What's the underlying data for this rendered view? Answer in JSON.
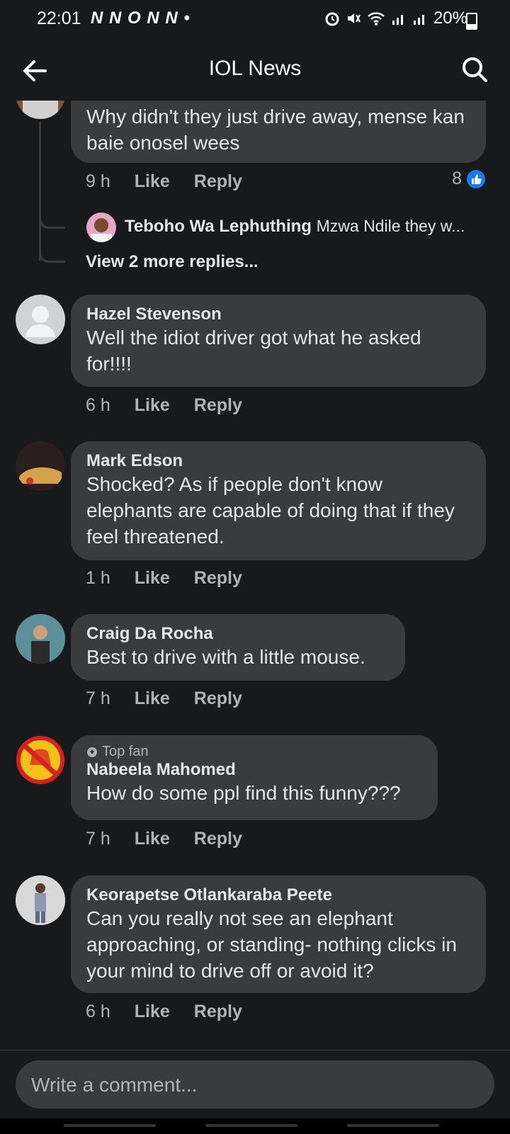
{
  "status_bar": {
    "time": "22:01",
    "notif_icons": "N N O N N •",
    "battery": "20%"
  },
  "header": {
    "title": "IOL News"
  },
  "comments": [
    {
      "id": "c0",
      "text": "Why didn't they just drive away, mense kan baie onosel wees",
      "time": "9 h",
      "like": "Like",
      "reply": "Reply",
      "reactions": "8",
      "reply_preview": {
        "name": "Teboho Wa Lephuthing",
        "text": "Mzwa Ndile they w..."
      },
      "view_more": "View 2 more replies..."
    },
    {
      "id": "c1",
      "name": "Hazel Stevenson",
      "text": "Well the idiot driver got what he asked for!!!!",
      "time": "6 h",
      "like": "Like",
      "reply": "Reply"
    },
    {
      "id": "c2",
      "name": "Mark Edson",
      "text": "Shocked? As if people don't know elephants are capable of doing that if they feel threatened.",
      "time": "1 h",
      "like": "Like",
      "reply": "Reply"
    },
    {
      "id": "c3",
      "name": "Craig Da Rocha",
      "text": "Best to drive with a little mouse.",
      "time": "7 h",
      "like": "Like",
      "reply": "Reply"
    },
    {
      "id": "c4",
      "badge": "Top fan",
      "name": "Nabeela Mahomed",
      "text": "How do some ppl find this funny???",
      "time": "7 h",
      "like": "Like",
      "reply": "Reply"
    },
    {
      "id": "c5",
      "name": "Keorapetse Otlankaraba Peete",
      "text": "Can you really not see an elephant approaching, or standing- nothing clicks in your mind to drive off or avoid it?",
      "time": "6 h",
      "like": "Like",
      "reply": "Reply"
    }
  ],
  "composer": {
    "placeholder": "Write a comment..."
  },
  "colors": {
    "background": "#18191a",
    "bubble": "#3a3b3c",
    "like_blue": "#1877f2",
    "meta": "#b0b3b8"
  }
}
